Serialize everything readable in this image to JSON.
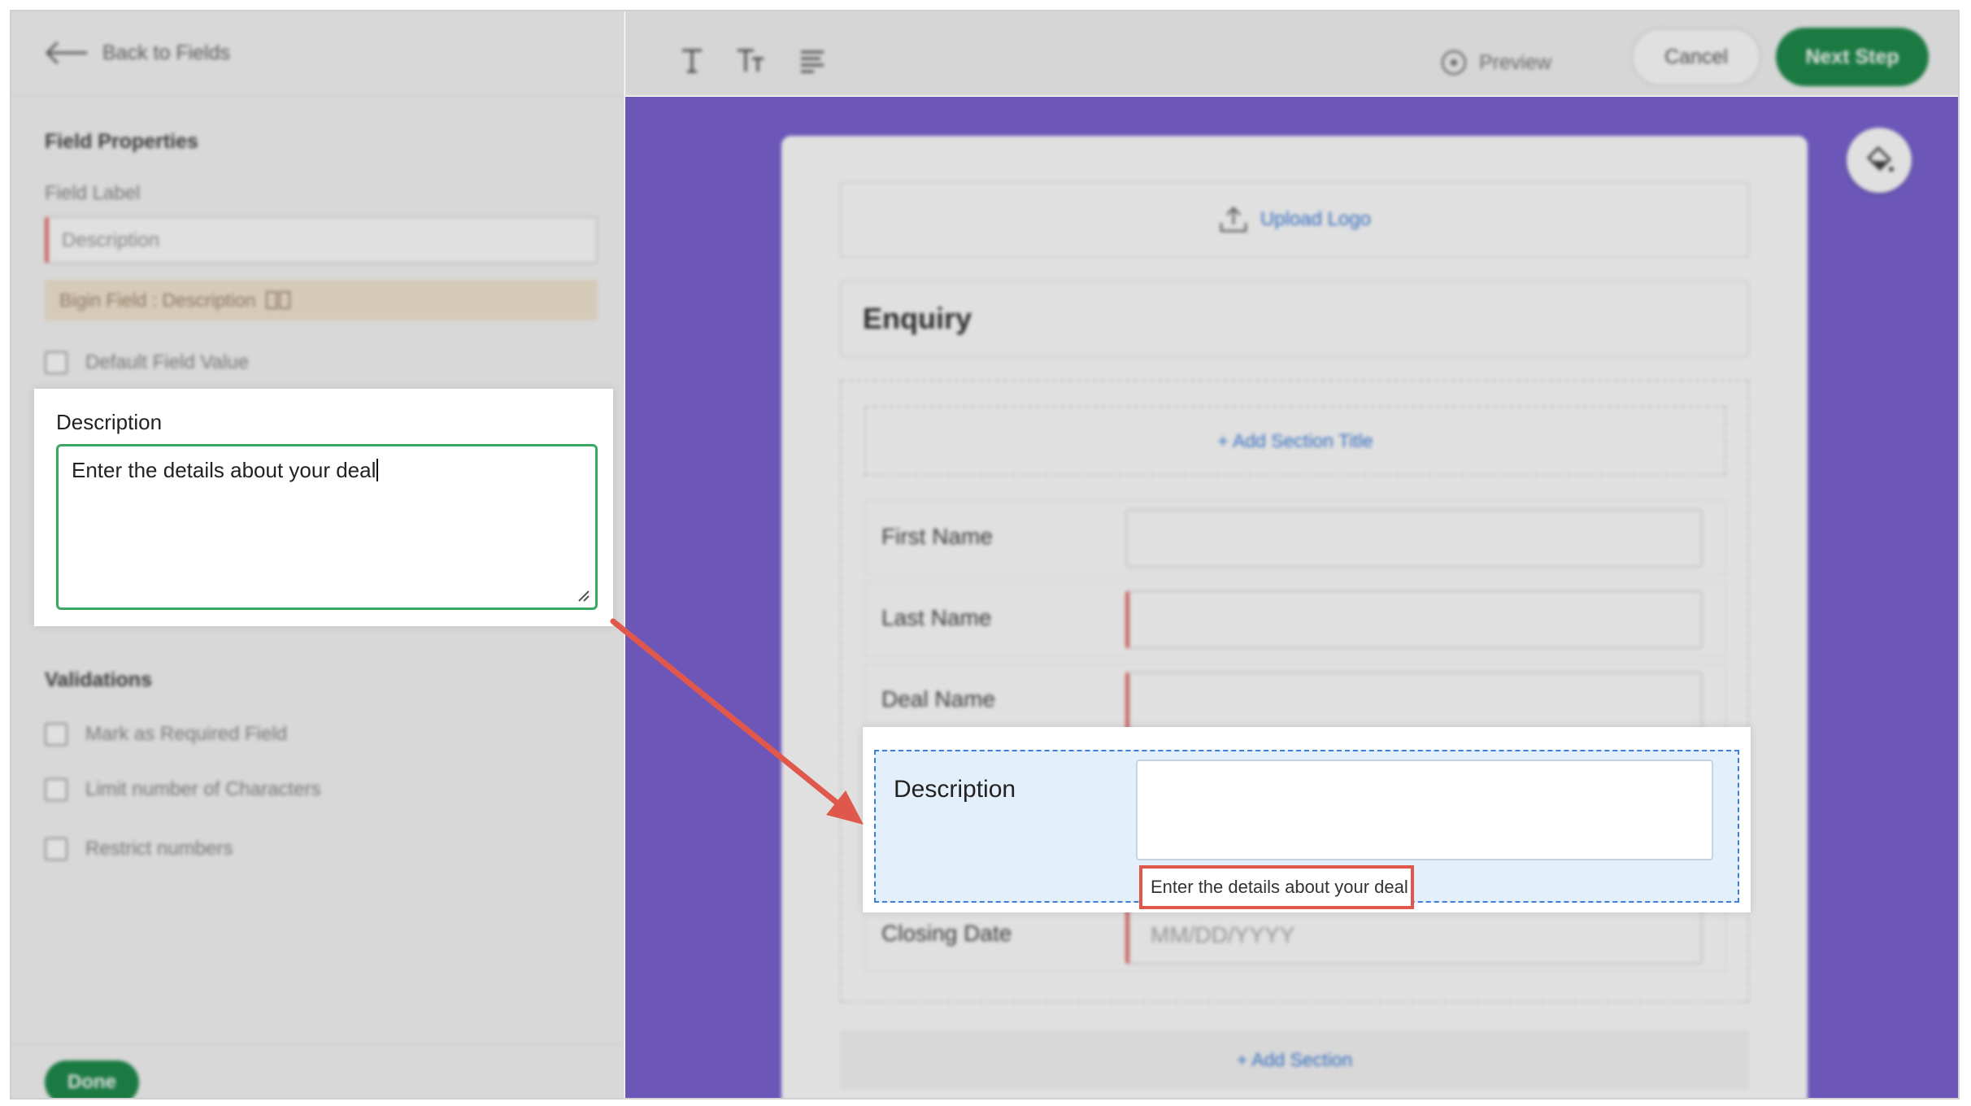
{
  "left_panel": {
    "back_label": "Back to Fields",
    "title": "Field Properties",
    "field_label_caption": "Field Label",
    "field_label_value": "Description",
    "bigin_field_text": "Bigin Field : Description",
    "default_value_label": "Default Field Value",
    "description_label": "Description",
    "description_value": "Enter the details about your deal",
    "validations_title": "Validations",
    "validations": [
      {
        "label": "Mark as Required Field"
      },
      {
        "label": "Limit number of Characters"
      },
      {
        "label": "Restrict numbers"
      }
    ],
    "done_label": "Done"
  },
  "toolbar": {
    "tools": [
      "text-icon",
      "text-size-icon",
      "align-icon"
    ],
    "preview_label": "Preview",
    "cancel_label": "Cancel",
    "next_label": "Next Step"
  },
  "form": {
    "upload_logo_label": "Upload Logo",
    "title": "Enquiry",
    "add_section_title_label": "+ Add Section Title",
    "fields": [
      {
        "label": "First Name",
        "required": false,
        "placeholder": ""
      },
      {
        "label": "Last Name",
        "required": true,
        "placeholder": ""
      },
      {
        "label": "Deal Name",
        "required": true,
        "placeholder": ""
      }
    ],
    "description_field": {
      "label": "Description",
      "hint": "Enter the details about your deal"
    },
    "closing_date": {
      "label": "Closing Date",
      "placeholder": "MM/DD/YYYY"
    },
    "add_section_label": "+ Add Section"
  },
  "colors": {
    "canvas_bg": "#7b64d2",
    "primary_green": "#1f8b4c",
    "highlight_red": "#e0584c",
    "link_blue": "#3d7ed8"
  }
}
